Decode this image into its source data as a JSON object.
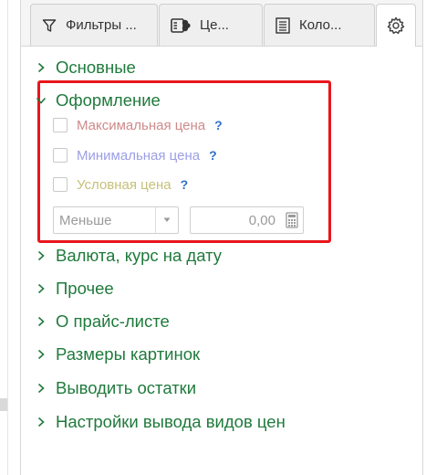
{
  "tabs": [
    {
      "label": "Фильтры ...",
      "icon": "filter-icon"
    },
    {
      "label": "Це...",
      "icon": "price-list-icon"
    },
    {
      "label": "Коло...",
      "icon": "columns-icon"
    },
    {
      "label": "",
      "icon": "gear-icon"
    }
  ],
  "sections": {
    "basic": "Основные",
    "design": "Оформление",
    "currency": "Валюта, курс на дату",
    "other": "Прочее",
    "about": "О прайс-листе",
    "image_sizes": "Размеры картинок",
    "stock": "Выводить остатки",
    "price_types": "Настройки вывода видов цен"
  },
  "design_options": {
    "max_price": {
      "label": "Максимальная цена",
      "help": "?",
      "color": "#cf8a8a",
      "checked": false
    },
    "min_price": {
      "label": "Минимальная цена",
      "help": "?",
      "color": "#9b9fe6",
      "checked": false
    },
    "cond_price": {
      "label": "Условная цена",
      "help": "?",
      "color": "#c6c07a",
      "checked": false
    },
    "condition_select": "Меньше",
    "condition_value": "0,00"
  },
  "colors": {
    "accent_green": "#1f7a3c",
    "highlight_red": "#e8161b",
    "help_blue": "#2f6fc9"
  }
}
